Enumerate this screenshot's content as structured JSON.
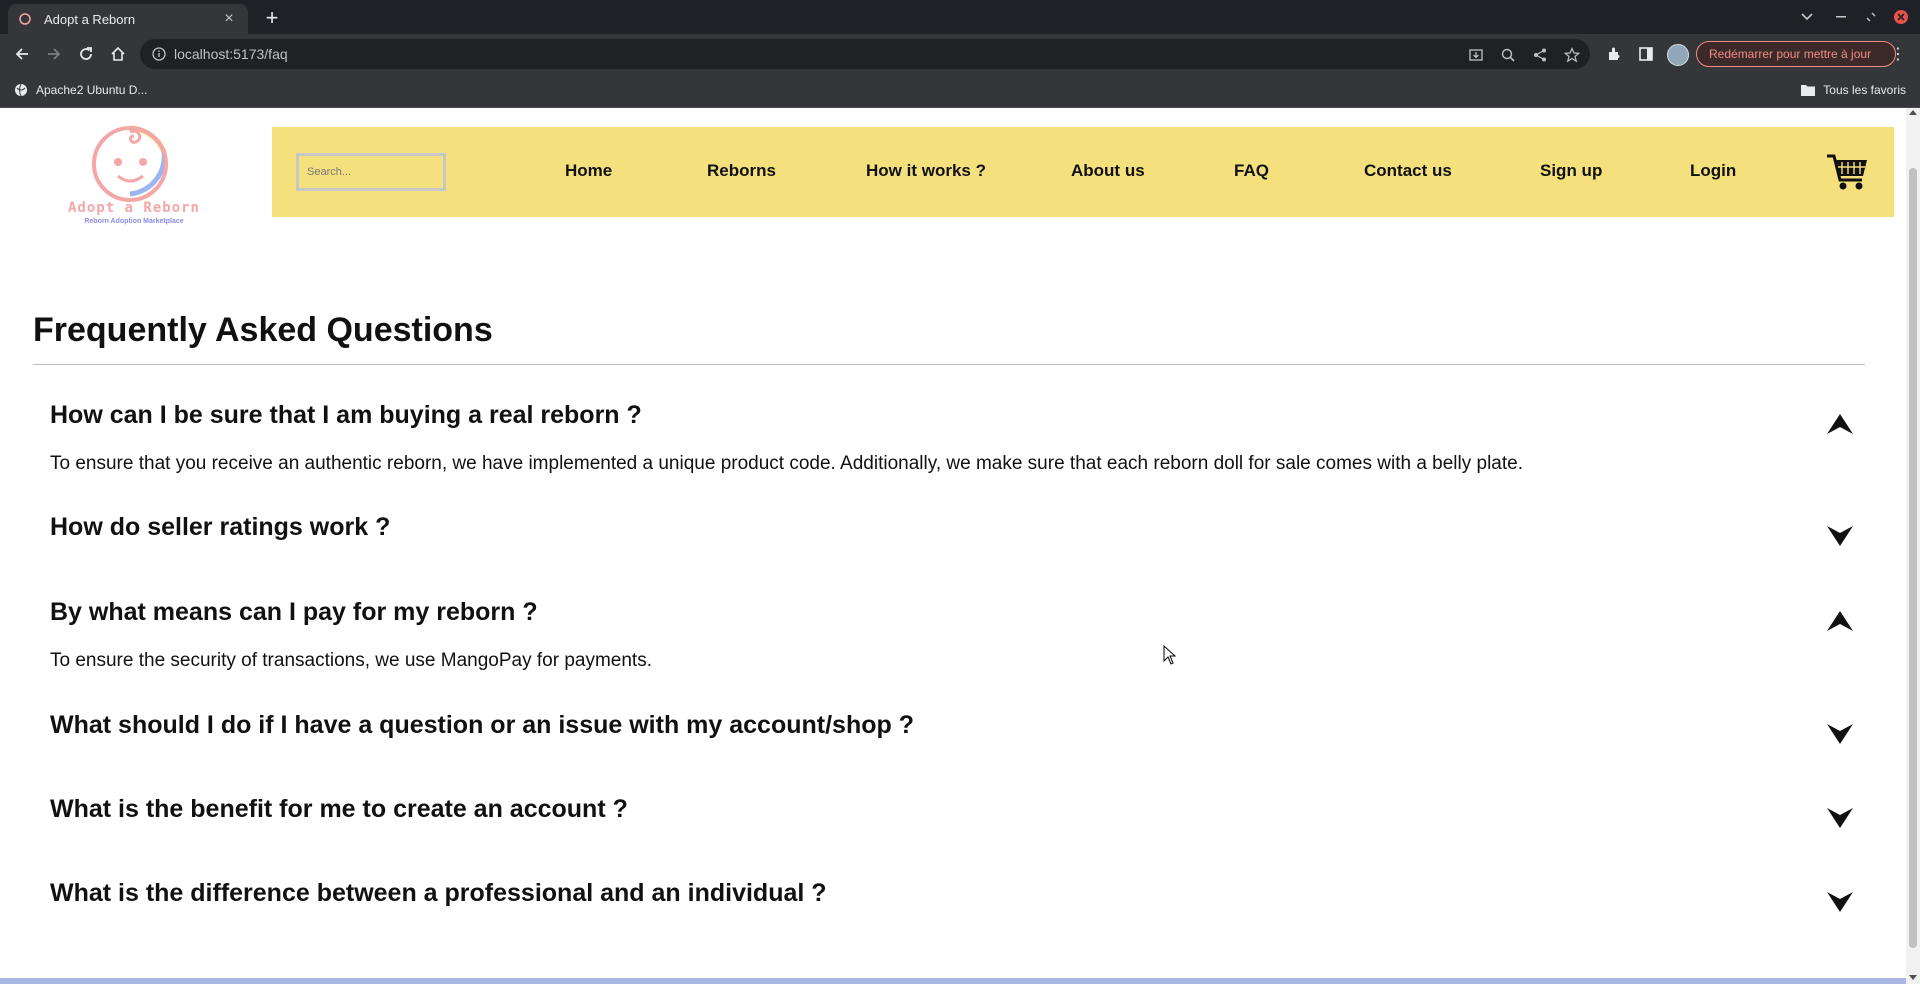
{
  "browser": {
    "tab_title": "Adopt a Reborn",
    "new_tab_icon": "plus-icon",
    "url": "localhost:5173/faq",
    "update_button_label": "Redémarrer pour mettre à jour",
    "bookmark_label": "Apache2 Ubuntu D...",
    "all_bookmarks_label": "Tous les favoris"
  },
  "site": {
    "logo_text": "Adopt a Reborn",
    "logo_subtitle": "Reborn Adoption Marketplace",
    "search_placeholder": "Search...",
    "nav": {
      "home": "Home",
      "reborns": "Reborns",
      "how_it_works": "How it works ?",
      "about_us": "About us",
      "faq": "FAQ",
      "contact_us": "Contact us",
      "sign_up": "Sign up",
      "login": "Login"
    },
    "colors": {
      "navbar_bg": "#f5e07e",
      "bottom_strip": "#a9b7e6"
    }
  },
  "faq": {
    "title": "Frequently Asked Questions",
    "items": [
      {
        "question": "How can I be sure that I am buying a real reborn ?",
        "answer": "To ensure that you receive an authentic reborn, we have implemented a unique product code. Additionally, we make sure that each reborn doll for sale comes with a belly plate.",
        "expanded": true
      },
      {
        "question": "How do seller ratings work ?",
        "answer": "",
        "expanded": false
      },
      {
        "question": "By what means can I pay for my reborn ?",
        "answer": "To ensure the security of transactions, we use MangoPay for payments.",
        "expanded": true
      },
      {
        "question": "What should I do if I have a question or an issue with my account/shop ?",
        "answer": "",
        "expanded": false
      },
      {
        "question": "What is the benefit for me to create an account ?",
        "answer": "",
        "expanded": false
      },
      {
        "question": "What is the difference between a professional and an individual ?",
        "answer": "",
        "expanded": false
      }
    ]
  }
}
